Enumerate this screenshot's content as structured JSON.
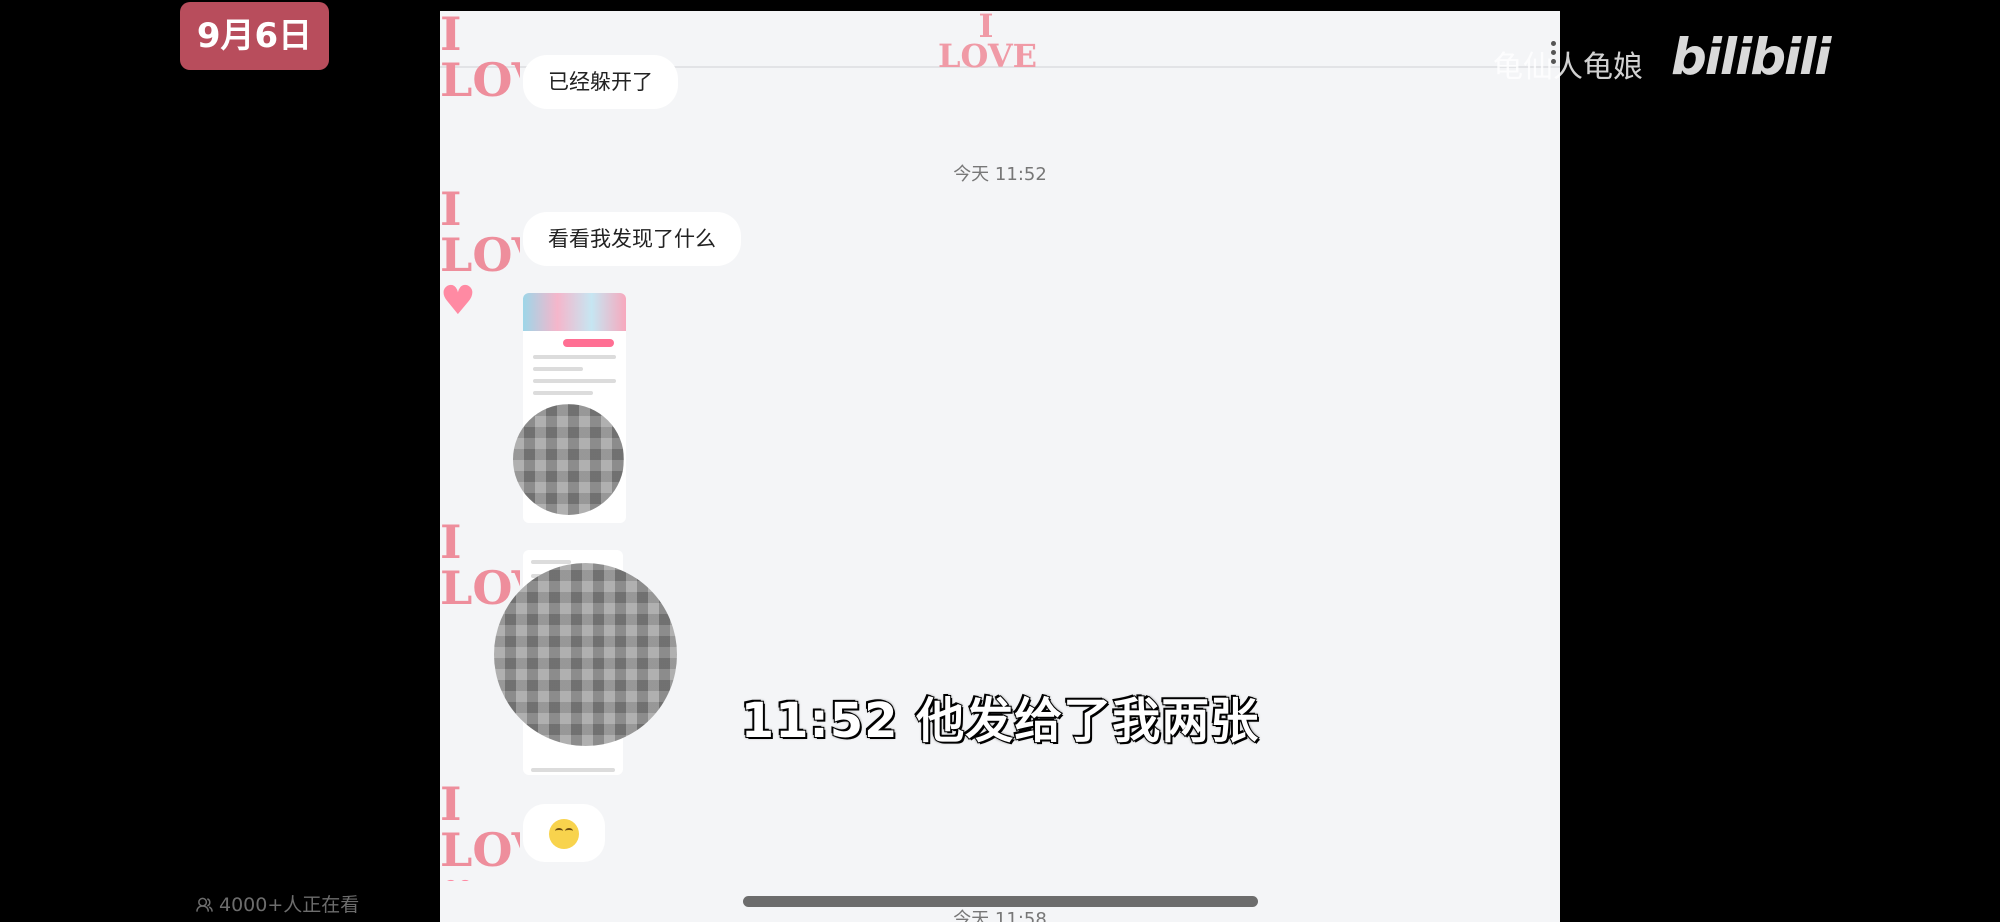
{
  "date_badge": "9月6日",
  "watermark": {
    "author": "龟仙人龟娘",
    "logo": "bilibili"
  },
  "viewers": "4000+人正在看",
  "subtitle": "11:52 他发给了我两张",
  "chat": {
    "messages": [
      {
        "type": "text",
        "text": "已经躲开了"
      },
      {
        "type": "timestamp",
        "text": "今天 11:52"
      },
      {
        "type": "text",
        "text": "看看我发现了什么"
      },
      {
        "type": "image"
      },
      {
        "type": "image"
      },
      {
        "type": "emoji",
        "icon": "eye-roll-emoji-icon"
      },
      {
        "type": "timestamp",
        "text": "今天 11:58"
      }
    ],
    "avatar_text": "I LOVE"
  },
  "colors": {
    "badge": "#b84d5c",
    "chat_bg": "#f4f5f7",
    "avatar_pink": "#ee8e9c",
    "scrollbar": "#6c6c6c"
  }
}
